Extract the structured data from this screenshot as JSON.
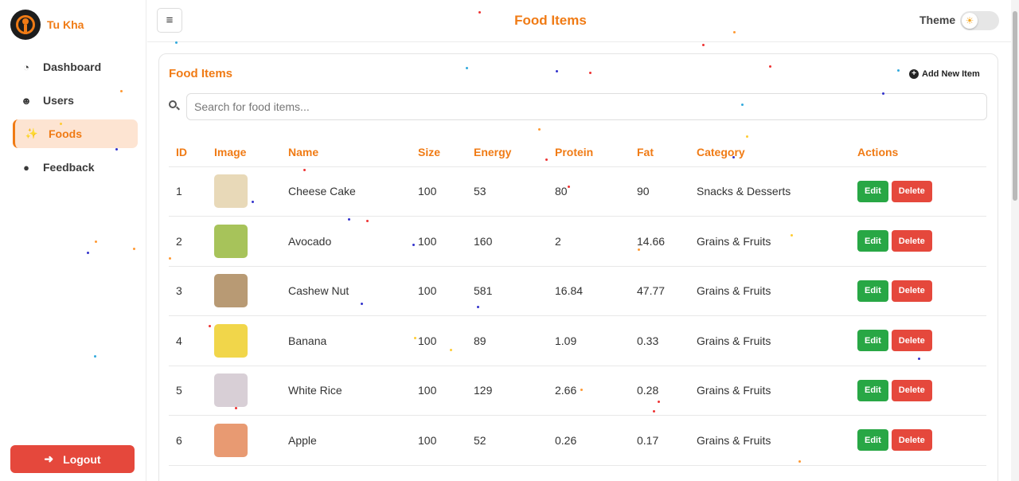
{
  "app": {
    "name": "Tu Kha"
  },
  "sidebar": {
    "items": [
      {
        "label": "Dashboard",
        "icon": "dashboard-icon"
      },
      {
        "label": "Users",
        "icon": "users-icon"
      },
      {
        "label": "Foods",
        "icon": "utensils-icon",
        "active": true
      },
      {
        "label": "Feedback",
        "icon": "comment-icon"
      }
    ],
    "logout_label": "Logout"
  },
  "header": {
    "title": "Food Items",
    "theme_label": "Theme",
    "theme_mode": "light"
  },
  "card": {
    "title": "Food Items",
    "add_label": "Add New Item",
    "search_placeholder": "Search for food items...",
    "columns": [
      "ID",
      "Image",
      "Name",
      "Size",
      "Energy",
      "Protein",
      "Fat",
      "Category",
      "Actions"
    ],
    "edit_label": "Edit",
    "delete_label": "Delete",
    "rows": [
      {
        "id": "1",
        "name": "Cheese Cake",
        "size": "100",
        "energy": "53",
        "protein": "80",
        "fat": "90",
        "category": "Snacks & Desserts",
        "thumb": "#e8d9b8"
      },
      {
        "id": "2",
        "name": "Avocado",
        "size": "100",
        "energy": "160",
        "protein": "2",
        "fat": "14.66",
        "category": "Grains & Fruits",
        "thumb": "#a7c35a"
      },
      {
        "id": "3",
        "name": "Cashew Nut",
        "size": "100",
        "energy": "581",
        "protein": "16.84",
        "fat": "47.77",
        "category": "Grains & Fruits",
        "thumb": "#b89a74"
      },
      {
        "id": "4",
        "name": "Banana",
        "size": "100",
        "energy": "89",
        "protein": "1.09",
        "fat": "0.33",
        "category": "Grains & Fruits",
        "thumb": "#f1d64a"
      },
      {
        "id": "5",
        "name": "White Rice",
        "size": "100",
        "energy": "129",
        "protein": "2.66",
        "fat": "0.28",
        "category": "Grains & Fruits",
        "thumb": "#d8cfd6"
      },
      {
        "id": "6",
        "name": "Apple",
        "size": "100",
        "energy": "52",
        "protein": "0.26",
        "fat": "0.17",
        "category": "Grains & Fruits",
        "thumb": "#e89a72"
      }
    ]
  },
  "colors": {
    "accent": "#f07b15",
    "edit": "#28a745",
    "delete": "#e5483c"
  }
}
